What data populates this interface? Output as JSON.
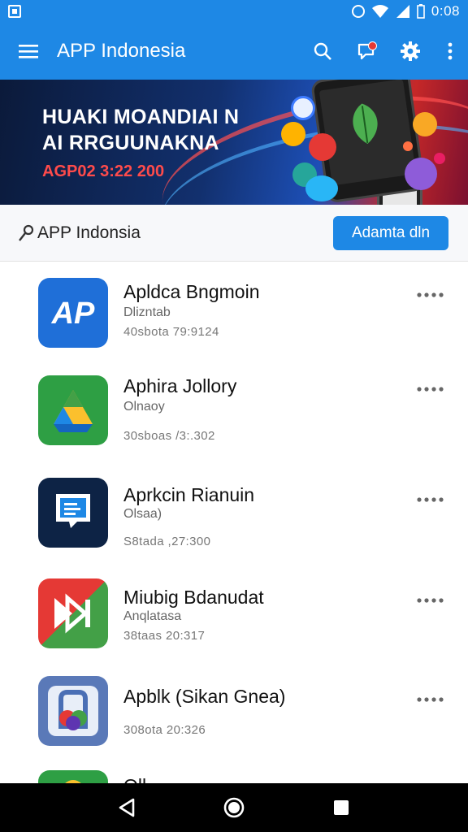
{
  "status_bar": {
    "time": "0:08"
  },
  "app_bar": {
    "title": "APP Indonesia"
  },
  "banner": {
    "line1": "HUAKI MOANDIAI N",
    "line2": "AI RRGUUNAKNA",
    "line3": "AGP02 3:22 200"
  },
  "section": {
    "title": "APP Indonsia",
    "add_label": "Adamta dln"
  },
  "apps": [
    {
      "name": "Apldca Bngmoin",
      "subtitle": "Dlizntab",
      "meta": "40sbota 79:9124",
      "icon": "ap-letter-icon"
    },
    {
      "name": "Aphira Jollory",
      "subtitle": "Olnaoy",
      "meta": "30sboas /3:.302",
      "icon": "triangle-drive-icon"
    },
    {
      "name": "Aprkcin Rianuin",
      "subtitle": "Olsaa)",
      "meta": "S8tada ,27:300",
      "icon": "chat-document-icon"
    },
    {
      "name": "Miubig Bdanudat",
      "subtitle": "Anqlatasa",
      "meta": "38taas 20:317",
      "icon": "play-arrows-icon"
    },
    {
      "name": "Apblk (Sikan Gnea)",
      "subtitle": "",
      "meta": "308ota 20:326",
      "icon": "bag-circle-icon"
    },
    {
      "name": "Oll..",
      "subtitle": "",
      "meta": "",
      "icon": "green-app-icon"
    }
  ],
  "colors": {
    "primary": "#1e88e5",
    "banner_dark": "#0b1a3a",
    "banner_red": "#ff4b4b",
    "nav": "#000000"
  }
}
